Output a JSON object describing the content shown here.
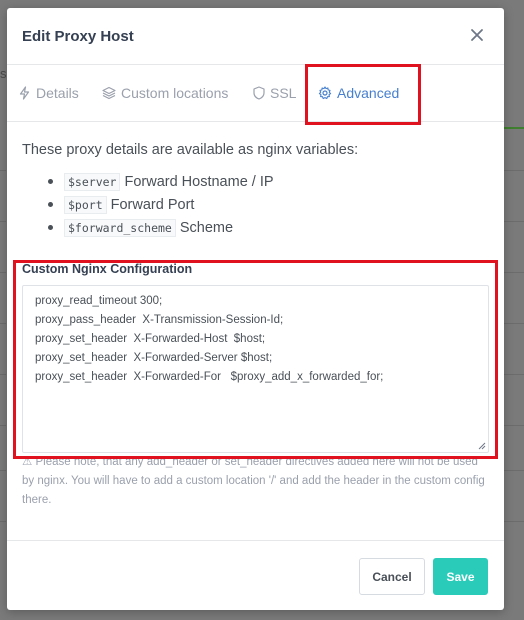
{
  "background": {
    "fragment_text": "sl"
  },
  "modal": {
    "title": "Edit Proxy Host",
    "close_icon": "close-icon"
  },
  "tabs": [
    {
      "label": "Details",
      "icon": "lightning-icon",
      "active": false
    },
    {
      "label": "Custom locations",
      "icon": "layers-icon",
      "active": false
    },
    {
      "label": "SSL",
      "icon": "shield-icon",
      "active": false
    },
    {
      "label": "Advanced",
      "icon": "gear-icon",
      "active": true
    }
  ],
  "advanced": {
    "intro": "These proxy details are available as nginx variables:",
    "variables": [
      {
        "code": "$server",
        "desc": "Forward Hostname / IP"
      },
      {
        "code": "$port",
        "desc": "Forward Port"
      },
      {
        "code": "$forward_scheme",
        "desc": "Scheme"
      }
    ],
    "config_label": "Custom Nginx Configuration",
    "config_lines": [
      "proxy_read_timeout 300;",
      "proxy_pass_header  X-Transmission-Session-Id;",
      "proxy_set_header  X-Forwarded-Host  $host;",
      "proxy_set_header  X-Forwarded-Server $host;",
      "proxy_set_header  X-Forwarded-For   $proxy_add_x_forwarded_for;"
    ],
    "note": "⚠ Please note, that any add_header or set_header directives added here will not be used by nginx. You will have to add a custom location '/' and add the header in the custom config there."
  },
  "footer": {
    "cancel_label": "Cancel",
    "save_label": "Save"
  },
  "colors": {
    "accent": "#467fcf",
    "save": "#2bcbba",
    "highlight": "#e0121f"
  }
}
